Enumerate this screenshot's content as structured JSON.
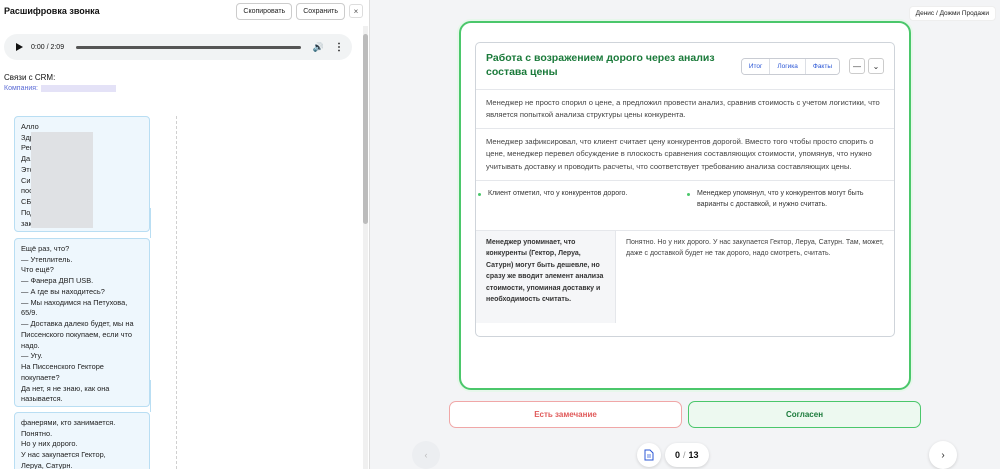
{
  "transcript_panel": {
    "title": "Расшифровка звонка",
    "copy_label": "Скопировать",
    "save_label": "Сохранить",
    "close_label": "×"
  },
  "audio": {
    "time": "0:00 / 2:09",
    "volume_icon": "volume-icon",
    "more_icon": "more-vertical-icon"
  },
  "crm": {
    "title": "Связи с CRM:",
    "company_label": "Компания:"
  },
  "messages": [
    "Алло\nЗдр\nРек\nДа.\nЭто\nСин\nпос\nСБу\nПод\nзак",
    "Ещё раз, что?\n— Утеплитель.\nЧто ещё?\n— Фанера ДВП USB.\n— А где вы находитесь?\n— Мы находимся на Петухова, 65/9.\n— Доставка далеко будет, мы на Писсенского покупаем, если что надо.\n— Угу.\nНа Писсенского Гекторе покупаете?\nДа нет, я не знаю, как она называется.",
    "фанерями, кто занимается.\nПонятно.\nНо у них дорого.\nУ нас закупается Гектор,\nЛеруа, Сатурн."
  ],
  "user_badge": "Денис / Дожми Продажи",
  "card": {
    "title": "Работа с возражением дорого через анализ состава цены",
    "tabs": [
      "Итог",
      "Логика",
      "Факты"
    ],
    "summary": "Менеджер не просто спорил о цене, а предложил провести анализ, сравнив стоимость с учетом логистики, что является попыткой анализа структуры цены конкурента.",
    "logic": "Менеджер зафиксировал, что клиент считает цену конкурентов дорогой. Вместо того чтобы просто спорить о цене, менеджер перевел обсуждение в плоскость сравнения составляющих стоимости, упомянув, что нужно учитывать доставку и проводить расчеты, что соответствует требованию анализа составляющих цены.",
    "fact_left": "Клиент отметил, что у конкурентов дорого.",
    "fact_right": "Менеджер упомянул, что у конкурентов могут быть варианты с доставкой, и нужно считать.",
    "quote_left": "Менеджер упоминает, что конкуренты (Гектор, Леруа, Сатурн) могут быть дешевле, но сразу же вводит элемент анализа стоимости, упоминая доставку и необходимость считать.",
    "quote_right": "Понятно. Но у них дорого. У нас закупается Гектор, Леруа, Сатурн. Там, может, даже с доставкой будет не так дорого, надо смотреть, считать."
  },
  "actions": {
    "remark_label": "Есть замечание",
    "agree_label": "Согласен"
  },
  "pager": {
    "current": "0",
    "separator": "/",
    "total": "13"
  },
  "colors": {
    "accent_green": "#4bc76b",
    "title_green": "#1a7a3a",
    "warn_red": "#e05a5a",
    "link_blue": "#2b57d6",
    "bubble_bg": "#eef7fd"
  }
}
